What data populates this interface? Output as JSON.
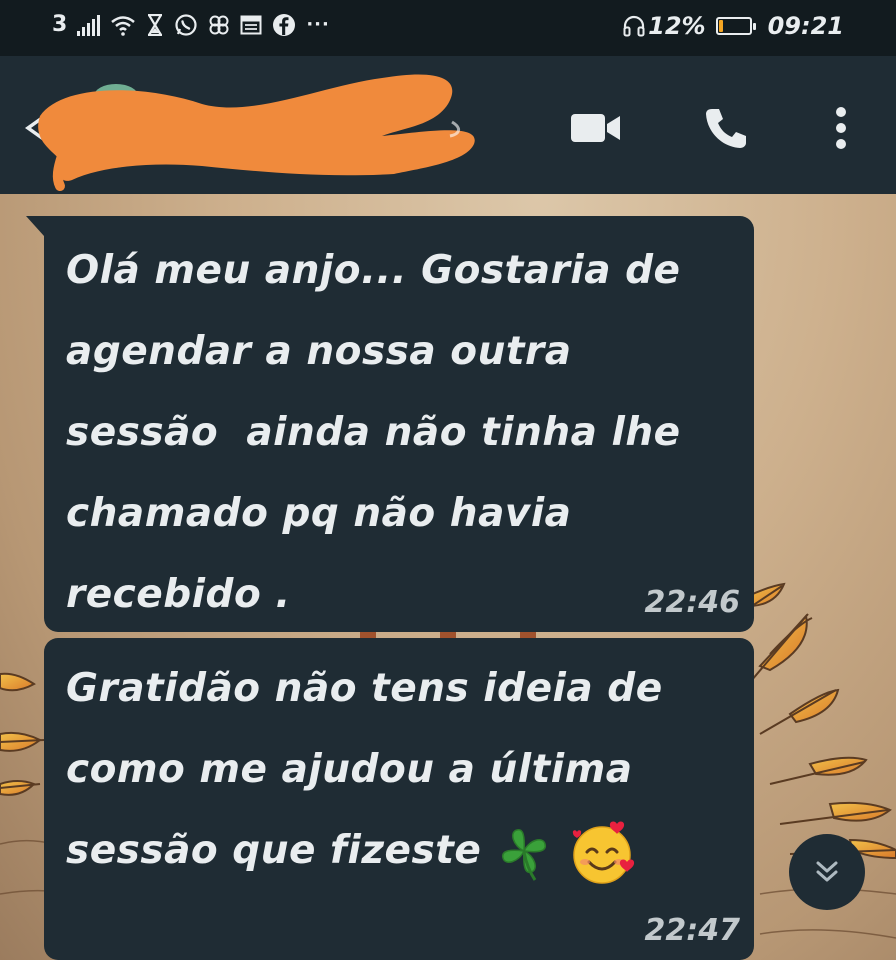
{
  "status_bar": {
    "carrier_indicator": "3",
    "battery_percent": "12%",
    "battery_level": 0.12,
    "time": "09:21",
    "more_glyph": "···",
    "icons": [
      "signal-icon",
      "wifi-icon",
      "hourglass-icon",
      "whatsapp-icon",
      "pinwheel-icon",
      "calendar-icon",
      "facebook-icon",
      "more-dots-icon",
      "headset-icon",
      "battery-icon"
    ]
  },
  "app_bar": {
    "contact_name_redacted": true,
    "icons": [
      "back-arrow-icon",
      "video-call-icon",
      "voice-call-icon",
      "more-options-icon"
    ]
  },
  "messages": [
    {
      "text": "Olá meu anjo... Gostaria de\nagendar a nossa outra\nsessão  ainda não tinha lhe\nchamado pq não havia\nrecebido .",
      "time": "22:46"
    },
    {
      "text": "Gratidão não tens ideia de\ncomo me ajudou a última\nsessão que fizeste",
      "emojis": [
        "four-leaf-clover-icon",
        "smiling-face-with-hearts-icon"
      ],
      "time": "22:47"
    }
  ],
  "colors": {
    "bubble": "#1f2c34",
    "app_bar": "#1f2c34",
    "status_bar": "#121b1f",
    "redaction": "#f08a3c",
    "battery": "#f5a623"
  }
}
